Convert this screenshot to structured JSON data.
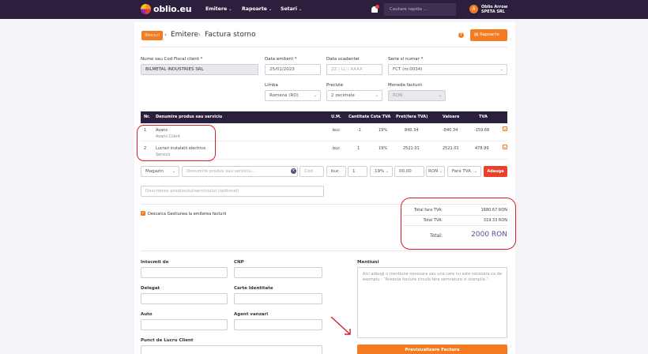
{
  "topnav": {
    "brand": "oblio.eu",
    "menu": [
      {
        "label": "Emitere"
      },
      {
        "label": "Rapoarte"
      },
      {
        "label": "Setari"
      }
    ],
    "search_placeholder": "Cautare rapida ...",
    "user": {
      "initial": "A",
      "name": "Oblio Arrow",
      "company": "SPETA SRL"
    }
  },
  "header": {
    "badge": "Stocuri",
    "crumb1": "Emitere",
    "crumb2": "Factura storno",
    "help": "?",
    "rapoarte_button": "Rapoarte"
  },
  "form": {
    "client_label": "Nume sau Cod Fiscal client *",
    "client_value": "BILMETAL INDUSTRIES SRL",
    "date_label": "Data emiterii *",
    "date_value": "25/01/2023",
    "due_label": "Data scadentei",
    "due_placeholder": "ZZ / LL / AAAA",
    "series_label": "Serie si numar *",
    "series_value": "FCT (nr.0034)",
    "lang_label": "Limba",
    "lang_value": "Romana (RO)",
    "precision_label": "Precizie",
    "precision_value": "2 zecimale",
    "currency_label": "Moneda facturii",
    "currency_value": "RON"
  },
  "table": {
    "headers": [
      "Nr.",
      "Denumire produs sau serviciu",
      "U.M.",
      "Cantitate",
      "Cota TVA",
      "Pret(fara TVA)",
      "Valoare",
      "TVA"
    ],
    "rows": [
      {
        "nr": "1",
        "name": "Avans",
        "desc": "Avans Client",
        "um": "buc",
        "qty": "-1",
        "vat": "19%",
        "price": "840.34",
        "value": "-840.34",
        "tva": "-159.66"
      },
      {
        "nr": "2",
        "name": "Lucrari instalatii electrice",
        "desc": "Servicii",
        "um": "buc",
        "qty": "1",
        "vat": "19%",
        "price": "2521.01",
        "value": "2521.01",
        "tva": "478.99"
      }
    ]
  },
  "add_row": {
    "gestiune": "Magazin",
    "product_placeholder": "Denumire produs sau serviciu...",
    "cod_placeholder": "Cod",
    "um": "buc",
    "qty": "1",
    "vat": "19%",
    "price": "00.00",
    "currency": "RON",
    "vat_mode": "Fara TVA",
    "add_button": "Adauga",
    "description_placeholder": "Descrierea produsului/serviciului (optional)"
  },
  "checkbox_label": "Descarca Gestiunea la emiterea facturii",
  "totals": {
    "net_label": "Total fara TVA:",
    "net_value": "1680.67 RON",
    "vat_label": "Total TVA:",
    "vat_value": "319.33 RON",
    "total_label": "Total:",
    "total_value": "2000 RON"
  },
  "bottom": {
    "intocmit_label": "Intocmit de",
    "cnp_label": "CNP",
    "delegat_label": "Delegat",
    "carte_label": "Carte Identitate",
    "auto_label": "Auto",
    "agent_label": "Agent vanzari",
    "punct_label": "Punct de Lucru Client",
    "mentiuni_label": "Mentiuni",
    "mentiuni_placeholder": "Aici adaugi o mentiune necesara sau una care nu este necesara ca de exemplu : \"Aceasta factura circula fara semnatura si stampila.\"",
    "preview_button": "Previzualizare Factura"
  },
  "colors": {
    "nav": "#2b1f3d",
    "accent": "#f47b20",
    "annotation": "#d91d2a",
    "total": "#5b4a9a"
  }
}
